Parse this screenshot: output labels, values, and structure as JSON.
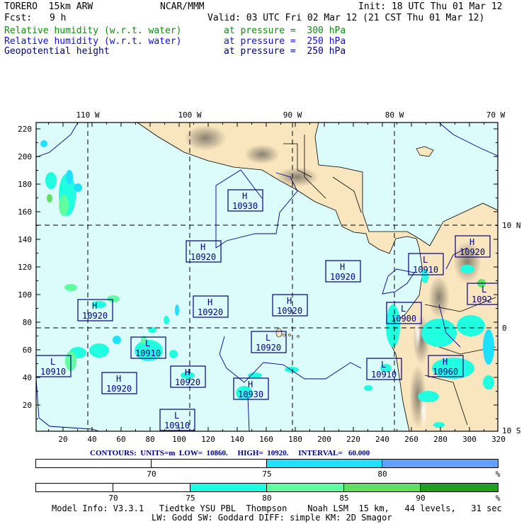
{
  "header": {
    "model": "TORERO  15km ARW",
    "org": "NCAR/MMM",
    "init": "Init: 18 UTC Thu 01 Mar 12",
    "fcst_label": "Fcst:",
    "fcst_value": "9 h",
    "valid": "Valid: 03 UTC Fri 02 Mar 12 (21 CST Thu 01 Mar 12)"
  },
  "fields": [
    {
      "name": "Relative humidity (w.r.t. water)",
      "level": "at pressure =  300 hPa",
      "color": "#138a13"
    },
    {
      "name": "Relative humidity (w.r.t. water)",
      "level": "at pressure =  250 hPa",
      "color": "#1010e0"
    },
    {
      "name": "Geopotential height",
      "level": "at pressure =  250 hPa",
      "color": "#000080"
    }
  ],
  "map": {
    "top_lon_labels": [
      "110 W",
      "100 W",
      "90 W",
      "80 W",
      "70 W"
    ],
    "right_lat_labels": [
      "10 N",
      "0",
      "10 S"
    ],
    "y_tick_labels": [
      "220",
      "200",
      "180",
      "160",
      "140",
      "120",
      "100",
      "80",
      "60",
      "40",
      "20"
    ],
    "x_tick_labels": [
      "20",
      "40",
      "60",
      "80",
      "100",
      "120",
      "140",
      "160",
      "180",
      "200",
      "220",
      "240",
      "260",
      "280",
      "300",
      "320"
    ],
    "centers": [
      {
        "type": "H",
        "value": "10930"
      },
      {
        "type": "H",
        "value": "10920"
      },
      {
        "type": "H",
        "value": "10920"
      },
      {
        "type": "L",
        "value": "10910"
      },
      {
        "type": "H",
        "value": "10920"
      },
      {
        "type": "L",
        "value": "1092"
      },
      {
        "type": "H",
        "value": "10920"
      },
      {
        "type": "H",
        "value": "10920"
      },
      {
        "type": "H",
        "value": "10920"
      },
      {
        "type": "L",
        "value": "10900"
      },
      {
        "type": "L",
        "value": "10920"
      },
      {
        "type": "L",
        "value": "10910"
      },
      {
        "type": "L",
        "value": "10910"
      },
      {
        "type": "H",
        "value": "10920"
      },
      {
        "type": "H",
        "value": "10920"
      },
      {
        "type": "H",
        "value": "10930"
      },
      {
        "type": "L",
        "value": "10910"
      },
      {
        "type": "H",
        "value": "10960"
      },
      {
        "type": "L",
        "value": "10910"
      }
    ],
    "colors": {
      "ocean": "#dcfcfc",
      "land": "#fae6be",
      "contour": "#000080"
    }
  },
  "contours_info": "CONTOURS:  UNITS=m  LOW=  10860.     HIGH=  10920.     INTERVAL=   60.000",
  "colorbar_250": {
    "labels": [
      "70",
      "75",
      "80",
      "%"
    ],
    "colors": [
      "#ffffff",
      "#ffffff",
      "#1ee0ff",
      "#60a0ff"
    ]
  },
  "colorbar_300": {
    "labels": [
      "70",
      "75",
      "80",
      "85",
      "90",
      "%"
    ],
    "colors": [
      "#ffffff",
      "#ffffff",
      "#20ffe0",
      "#60ffa0",
      "#60e060",
      "#20a020"
    ]
  },
  "model_info": {
    "line1": "Model Info: V3.3.1   Tiedtke YSU PBL  Thompson    Noah LSM  15 km,   44 levels,   31 sec",
    "line2": "LW: Godd SW: Goddard DIFF: simple KM: 2D Smagor"
  }
}
